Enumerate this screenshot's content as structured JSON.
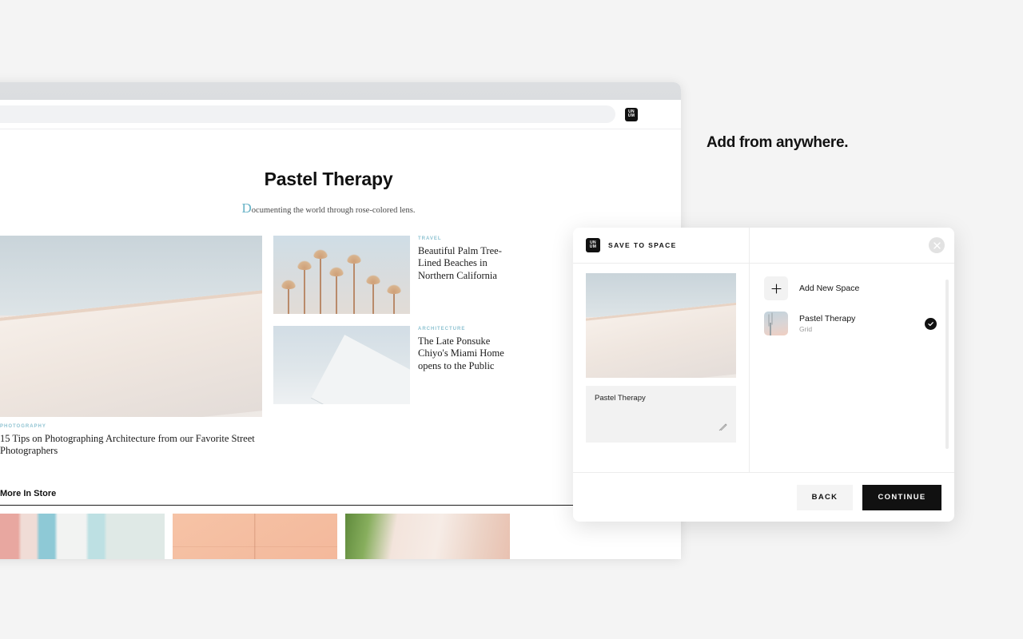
{
  "promo": {
    "headline": "Add from anywhere."
  },
  "browser": {
    "address_value": "",
    "address_placeholder": "",
    "extension_icon": "unum-logo-icon",
    "logo_top": "UN",
    "logo_bottom": "UM"
  },
  "site": {
    "title": "Pastel Therapy",
    "subtitle_dropcap": "D",
    "subtitle_rest": "ocumenting the world through rose-colored lens.",
    "hero": {
      "category": "PHOTOGRAPHY",
      "headline": "15 Tips on Photographing Architecture from our Favorite Street Photographers"
    },
    "side_articles": [
      {
        "category": "TRAVEL",
        "headline": "Beautiful Palm Tree-Lined Beaches in Northern California",
        "thumb": "palm-trees-photo"
      },
      {
        "category": "ARCHITECTURE",
        "headline": "The Late Ponsuke Chiyo's Miami Home opens to the Public",
        "thumb": "modern-building-photo"
      }
    ],
    "more_section": {
      "heading": "More In Store",
      "cards": [
        "pastel-doorways-photo",
        "peach-wall-photo",
        "bougainvillea-house-photo"
      ]
    }
  },
  "modal": {
    "logo_top": "UN",
    "logo_bottom": "UM",
    "title": "SAVE TO SPACE",
    "close_icon": "close-icon",
    "preview": {
      "image": "building-preview-photo",
      "caption": "Pastel Therapy",
      "edit_icon": "pencil-icon"
    },
    "spaces": [
      {
        "label": "Add New Space",
        "sub": "",
        "icon": "plus-icon",
        "selected": false
      },
      {
        "label": "Pastel Therapy",
        "sub": "Grid",
        "icon": "space-thumbnail",
        "selected": true
      }
    ],
    "buttons": {
      "back": "BACK",
      "continue": "CONTINUE"
    }
  },
  "colors": {
    "accent": "#8fc3d2",
    "dark": "#111111",
    "page_bg": "#f4f4f4",
    "panel": "#f2f2f2"
  }
}
